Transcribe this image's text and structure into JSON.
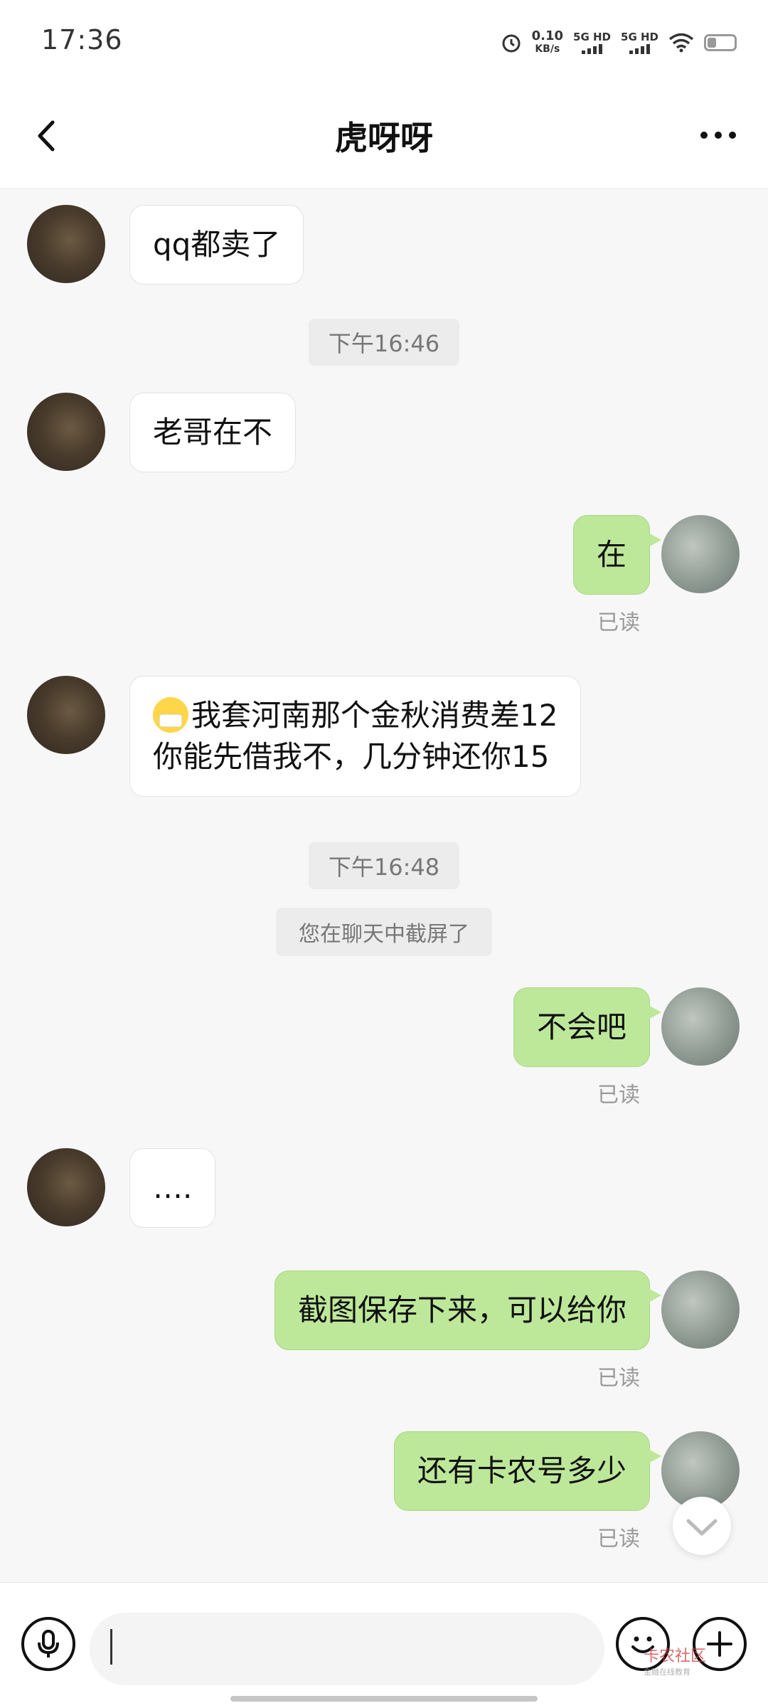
{
  "status_bar": {
    "time": "17:36",
    "net_speed_value": "0.10",
    "net_speed_unit": "KB/s",
    "sim1": "5G HD",
    "sim2": "5G HD"
  },
  "header": {
    "title": "虎呀呀",
    "back_icon": "chevron-left-icon",
    "more_icon": "more-horizontal-icon"
  },
  "messages": [
    {
      "type": "text",
      "side": "in",
      "text": "qq都卖了"
    },
    {
      "type": "time",
      "text": "下午16:46"
    },
    {
      "type": "text",
      "side": "in",
      "text": "老哥在不"
    },
    {
      "type": "text",
      "side": "out",
      "text": "在",
      "read_label": "已读"
    },
    {
      "type": "text",
      "side": "in",
      "emoji": "mask-face-emoji",
      "lines": [
        "我套河南那个金秋消费差12",
        "你能先借我不，几分钟还你15"
      ]
    },
    {
      "type": "time",
      "text": "下午16:48"
    },
    {
      "type": "system",
      "text": "您在聊天中截屏了"
    },
    {
      "type": "text",
      "side": "out",
      "text": "不会吧",
      "read_label": "已读"
    },
    {
      "type": "text",
      "side": "in",
      "text": "…."
    },
    {
      "type": "text",
      "side": "out",
      "text": "截图保存下来，可以给你",
      "read_label": "已读"
    },
    {
      "type": "text",
      "side": "out",
      "text": "还有卡农号多少",
      "read_label": "已读"
    }
  ],
  "input_bar": {
    "voice_icon": "microphone-icon",
    "emoji_icon": "emoji-icon",
    "plus_icon": "plus-icon",
    "input_value": ""
  },
  "watermark": {
    "text": "卡农社区",
    "subtext": "金融在线教育"
  },
  "colors": {
    "outgoing_bubble": "#bde89a",
    "incoming_bubble": "#ffffff",
    "background": "#f7f7f7"
  }
}
